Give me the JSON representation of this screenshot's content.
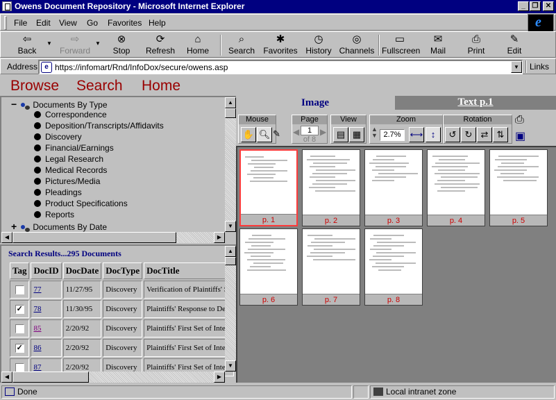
{
  "window": {
    "title": "Owens Document Repository - Microsoft Internet Explorer"
  },
  "menu": [
    "File",
    "Edit",
    "View",
    "Go",
    "Favorites",
    "Help"
  ],
  "toolbar": {
    "back": "Back",
    "forward": "Forward",
    "stop": "Stop",
    "refresh": "Refresh",
    "home": "Home",
    "search": "Search",
    "favorites": "Favorites",
    "history": "History",
    "channels": "Channels",
    "fullscreen": "Fullscreen",
    "mail": "Mail",
    "print": "Print",
    "edit": "Edit"
  },
  "address": {
    "label": "Address",
    "url": "https://infomart/Rnd/InfoDox/secure/owens.asp",
    "links": "Links"
  },
  "nav": {
    "browse": "Browse",
    "search": "Search",
    "home": "Home"
  },
  "tree": {
    "root1": "Documents By Type",
    "types": [
      "Correspondence",
      "Deposition/Transcripts/Affidavits",
      "Discovery",
      "Financial/Earnings",
      "Legal Research",
      "Medical Records",
      "Pictures/Media",
      "Pleadings",
      "Product Specifications",
      "Reports"
    ],
    "root2": "Documents By Date"
  },
  "results": {
    "title": "Search Results...295 Documents",
    "columns": [
      "Tag",
      "DocID",
      "DocDate",
      "DocType",
      "DocTitle"
    ],
    "rows": [
      {
        "checked": false,
        "id": "77",
        "date": "11/27/95",
        "type": "Discovery",
        "title": "Verification of Plaintiffs' Second"
      },
      {
        "checked": true,
        "id": "78",
        "date": "11/30/95",
        "type": "Discovery",
        "title": "Plaintiffs' Response to Defendant"
      },
      {
        "checked": false,
        "id": "85",
        "date": "2/20/92",
        "type": "Discovery",
        "title": "Plaintiffs' First Set of Interrogat"
      },
      {
        "checked": true,
        "id": "86",
        "date": "2/20/92",
        "type": "Discovery",
        "title": "Plaintiffs' First Set of Interrogat"
      },
      {
        "checked": false,
        "id": "87",
        "date": "2/20/92",
        "type": "Discovery",
        "title": "Plaintiffs' First Set of Interrogat"
      }
    ]
  },
  "viewer": {
    "tab_image": "Image",
    "tab_text": "Text p.1",
    "mouse": "Mouse",
    "page": "Page",
    "view": "View",
    "zoom": "Zoom",
    "rotation": "Rotation",
    "page_value": "1",
    "page_of": "of 8",
    "zoom_value": "2.7%"
  },
  "thumbnails": [
    "p. 1",
    "p. 2",
    "p. 3",
    "p. 4",
    "p. 5",
    "p. 6",
    "p. 7",
    "p. 8"
  ],
  "status": {
    "text": "Done",
    "zone": "Local intranet zone"
  },
  "colors": {
    "titlebar": "#000080",
    "nav_link": "#990000",
    "results_title": "#000080",
    "page_label": "#cc0000"
  }
}
